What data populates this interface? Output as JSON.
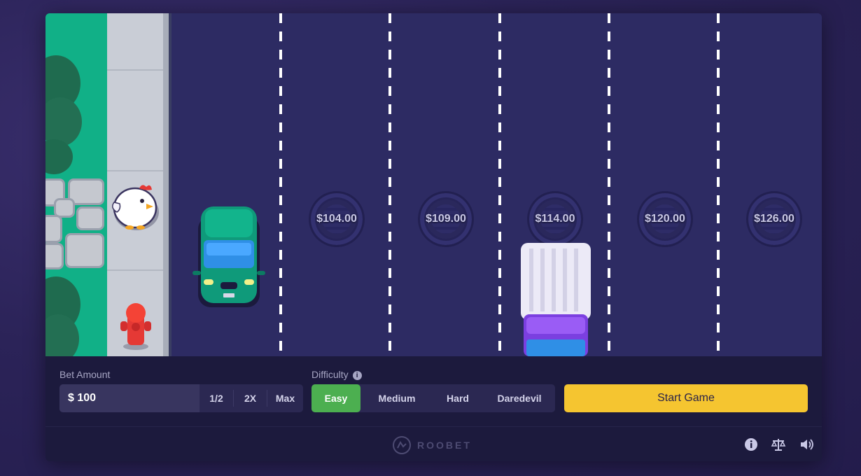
{
  "lanes": {
    "multipliers": [
      "$104.00",
      "$109.00",
      "$114.00",
      "$120.00",
      "$126.00"
    ]
  },
  "controls": {
    "bet_label": "Bet Amount",
    "bet_value": "$ 100",
    "bet_buttons": [
      "1/2",
      "2X",
      "Max"
    ],
    "difficulty_label": "Difficulty",
    "difficulty_options": [
      "Easy",
      "Medium",
      "Hard",
      "Daredevil"
    ],
    "difficulty_selected": "Easy",
    "start_label": "Start Game"
  },
  "footer": {
    "brand": "ROOBET",
    "icons": [
      "info-icon",
      "fairness-scale-icon",
      "sound-icon"
    ]
  },
  "colors": {
    "accent_yellow": "#f5c530",
    "selected_green": "#4caf50",
    "road": "#2d2b63",
    "grass": "#11b087"
  }
}
